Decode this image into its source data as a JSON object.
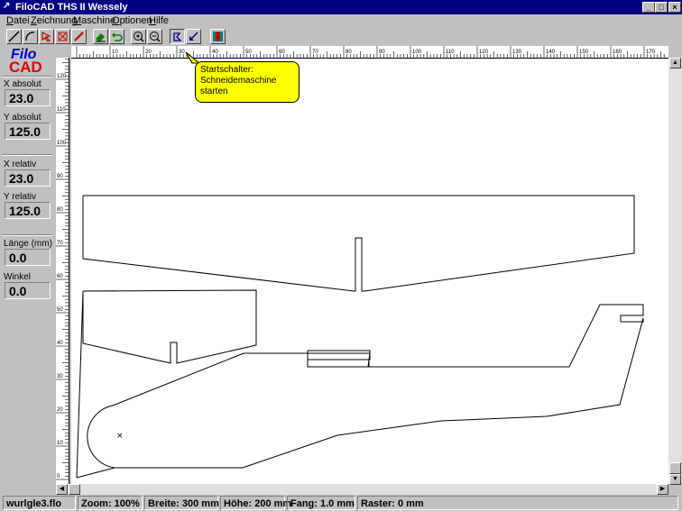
{
  "window": {
    "title": "FiloCAD   THS II Wessely",
    "minimize_icon": "minimize-icon",
    "maximize_icon": "maximize-icon",
    "close_icon": "close-icon"
  },
  "menu": [
    "Datei",
    "Zeichnung",
    "Maschine",
    "Optionen",
    "Hilfe"
  ],
  "toolbar": {
    "tools": [
      "line-tool-icon",
      "arc-tool-icon",
      "pointer-tool-icon",
      "delete-tool-icon",
      "pencil-tool-icon",
      "eraser-tool-icon",
      "undo-icon",
      "zoom-in-icon",
      "zoom-out-icon",
      "start-cutter-icon",
      "cutter-arrow-icon",
      "machine-icon"
    ]
  },
  "tooltip": {
    "line1": "Startschalter:",
    "line2": "Schneidemaschine",
    "line3": "starten"
  },
  "sidebar": {
    "logo_line1": "Filo",
    "logo_line2": "CAD",
    "x_abs_label": "X absolut",
    "x_abs_value": "23.0",
    "y_abs_label": "Y absolut",
    "y_abs_value": "125.0",
    "x_rel_label": "X relativ",
    "x_rel_value": "23.0",
    "y_rel_label": "Y relativ",
    "y_rel_value": "125.0",
    "length_label": "Länge (mm)",
    "length_value": "0.0",
    "angle_label": "Winkel",
    "angle_value": "0.0"
  },
  "ruler": {
    "h_labels": [
      "10",
      "20",
      "30",
      "40",
      "50",
      "60",
      "70",
      "80",
      "90",
      "100",
      "110",
      "120",
      "130",
      "140",
      "150",
      "160",
      "170"
    ],
    "v_labels": [
      "120",
      "110",
      "100",
      "90",
      "80",
      "70",
      "60",
      "50",
      "40",
      "30",
      "20",
      "10",
      "0"
    ]
  },
  "status": {
    "file": "wurlgle3.flo",
    "zoom": "Zoom: 100%",
    "width": "Breite: 300 mm",
    "height": "Höhe: 200 mm",
    "snap": "Fang:  1.0 mm",
    "grid": "Raster: 0 mm"
  }
}
